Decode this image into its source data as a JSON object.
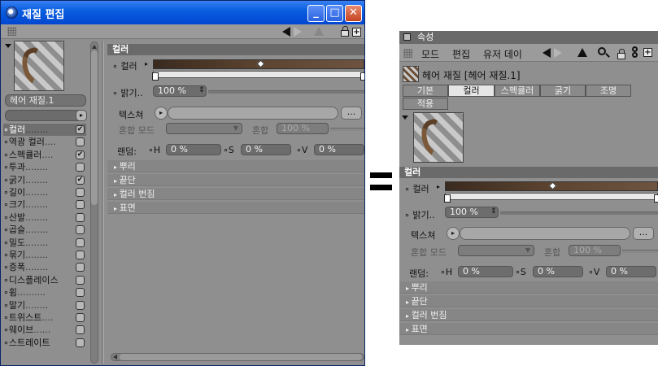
{
  "left_window": {
    "title": "재질 편집",
    "material_name": "헤어 재질.1",
    "channels": [
      {
        "label": "컬러",
        "dots": "........",
        "checked": true,
        "selected": true
      },
      {
        "label": "역광 컬러",
        "dots": "....",
        "checked": false
      },
      {
        "label": "스펙큘러",
        "dots": "....",
        "checked": true
      },
      {
        "label": "투과",
        "dots": "........",
        "checked": false
      },
      {
        "label": "굵기",
        "dots": "........",
        "checked": true
      },
      {
        "label": "길이",
        "dots": "........",
        "checked": false
      },
      {
        "label": "크기",
        "dots": "........",
        "checked": false
      },
      {
        "label": "산발",
        "dots": "........",
        "checked": false
      },
      {
        "label": "곱슬",
        "dots": "........",
        "checked": false
      },
      {
        "label": "밀도",
        "dots": "........",
        "checked": false
      },
      {
        "label": "묶기",
        "dots": "........",
        "checked": false
      },
      {
        "label": "증폭",
        "dots": "........",
        "checked": false
      },
      {
        "label": "디스플레이스",
        "dots": "",
        "checked": false
      },
      {
        "label": "휨",
        "dots": "..........",
        "checked": false
      },
      {
        "label": "말기",
        "dots": "........",
        "checked": false
      },
      {
        "label": "트위스트",
        "dots": "....",
        "checked": false
      },
      {
        "label": "웨이브",
        "dots": "......",
        "checked": false
      },
      {
        "label": "스트레이트",
        "dots": "",
        "checked": false
      }
    ]
  },
  "section_title": "컬러",
  "color_label": "컬러",
  "brightness_label": "밝기",
  "brightness_value": "100 %",
  "texture_label": "텍스쳐",
  "texture_btn": "...",
  "blend_mode_label": "혼합 모드",
  "blend_label": "혼합",
  "blend_value": "100 %",
  "random_label": "랜덤:",
  "h_label": "H",
  "s_label": "S",
  "v_label": "V",
  "h_value": "0 %",
  "s_value": "0 %",
  "v_value": "0 %",
  "folds": [
    "뿌리",
    "끝단",
    "컬러 번짐",
    "표면"
  ],
  "equals": "=",
  "right_panel": {
    "title": "속성",
    "menu": [
      "모드",
      "편집",
      "유저 데이"
    ],
    "material_header": "헤어 재질 [헤어 재질.1]",
    "tabs": [
      "기본",
      "컬러",
      "스펙큘러",
      "굵기",
      "조명",
      "적용"
    ],
    "active_tab": "컬러"
  }
}
